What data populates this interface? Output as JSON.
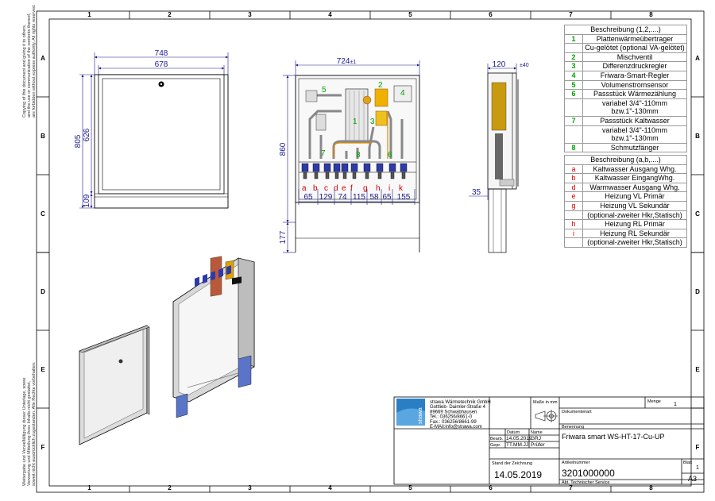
{
  "grid": {
    "columns": [
      "1",
      "2",
      "3",
      "4",
      "5",
      "6",
      "7",
      "8"
    ],
    "rows": [
      "A",
      "B",
      "C",
      "D",
      "E",
      "F"
    ]
  },
  "dimensions": {
    "front_outer_width": "748",
    "front_inner_width": "678",
    "height_total": "805",
    "height_inner": "626",
    "height_bottom": "109",
    "open_width": "724",
    "open_width_tol": "±1",
    "open_height": "860",
    "open_foot": "177",
    "spacing": [
      "65",
      "129",
      "74",
      "115",
      "58",
      "65",
      "155"
    ],
    "side_depth": "120",
    "side_depth_tol": "±40",
    "side_offset": "35"
  },
  "component_labels": [
    "1",
    "2",
    "3",
    "4",
    "5",
    "6",
    "7",
    "8"
  ],
  "connection_labels": [
    "a",
    "b",
    "c",
    "d",
    "e",
    "f",
    "g",
    "h",
    "i",
    "k"
  ],
  "legend_numbers": {
    "title": "Beschreibung (1,2,....)",
    "rows": [
      {
        "n": "1",
        "t": "Plattenwärmeübertrager"
      },
      {
        "n": "",
        "t": "Cu-gelötet (optional VA-gelötet)"
      },
      {
        "n": "2",
        "t": "Mischventil"
      },
      {
        "n": "3",
        "t": "Differenzdruckregler"
      },
      {
        "n": "4",
        "t": "Friwara-Smart-Regler"
      },
      {
        "n": "5",
        "t": "Volumenstromsensor"
      },
      {
        "n": "6",
        "t": "Passstück Wärmezählung"
      },
      {
        "n": "",
        "t": "variabel 3/4\"-110mm bzw.1\"-130mm"
      },
      {
        "n": "7",
        "t": "Passstück Kaltwasser"
      },
      {
        "n": "",
        "t": "variabel 3/4\"-110mm bzw.1\"-130mm"
      },
      {
        "n": "8",
        "t": "Schmutzfänger"
      }
    ]
  },
  "legend_letters": {
    "title": "Beschreibung (a,b,....)",
    "rows": [
      {
        "n": "a",
        "t": "Kaltwasser Ausgang Whg."
      },
      {
        "n": "b",
        "t": "Kaltwasser EingangWhg."
      },
      {
        "n": "d",
        "t": "Warmwasser Ausgang Whg."
      },
      {
        "n": "e",
        "t": "Heizung VL Primär"
      },
      {
        "n": "g",
        "t": "Heizung VL Sekundär"
      },
      {
        "n": "",
        "t": "(optional-zweiter Hkr,Statisch)"
      },
      {
        "n": "h",
        "t": "Heizung RL Primär"
      },
      {
        "n": "i",
        "t": "Heizung RL Sekundär"
      },
      {
        "n": "",
        "t": "(optional-zweiter Hkr,Statisch)"
      }
    ]
  },
  "title_block": {
    "company_lines": [
      "strawa Wärmetechnik GmbH",
      "Gottlieb- Daimler-Straße 4",
      "89669 Schwabhausen",
      "Tel.: 036256/8661-0",
      "Fax.: 036256/8661-99",
      "E-MAil:info@strawa.com"
    ],
    "logo_text": "strawa",
    "masse_label": "Maße in mm",
    "menge_label": "Menge",
    "menge_value": "1",
    "dokumentenart_label": "Dokumentenart",
    "benennung_label": "Benennung",
    "benennung_value": "Friwara smart WS-HT-17-Cu-UP",
    "datum_label": "Datum",
    "name_label": "Name",
    "bearb_label": "Bearb.",
    "bearb_date": "14.05.2019",
    "bearb_name": "GRJ",
    "gepr_label": "Gepr.",
    "gepr_date": "TT.MM.JJ",
    "gepr_name": "Prüfer",
    "stand_label": "Stand der Zeichnung",
    "stand_value": "14.05.2019",
    "artikel_label": "Artikelnummer",
    "artikel_value": "3201000000",
    "abt_label": "Abt. Technischer Service",
    "blatt_label": "Blatt",
    "blatt_value": "1",
    "format_value": "A3"
  },
  "side_notes": {
    "top": [
      "Copying of this document and giving it to others,",
      "and the use or communication of the contents thereof,",
      "are forbidden without express authority. All rights reserved."
    ],
    "bottom": [
      "Weitergabe und Vervielfältigung dieser Unterlage, sowie",
      "Verwertung und Mitteilung ihres Inhalts nicht gestattet,",
      "soweit nicht ausdrücklich zugestanden. Alle Rechte vorbehalten."
    ]
  },
  "colors": {
    "dimension": "#1a1a8c",
    "frame": "#000000",
    "component_green": "#00a000",
    "connection_red": "#d40000",
    "logo_blue": "#2a7fc4"
  }
}
